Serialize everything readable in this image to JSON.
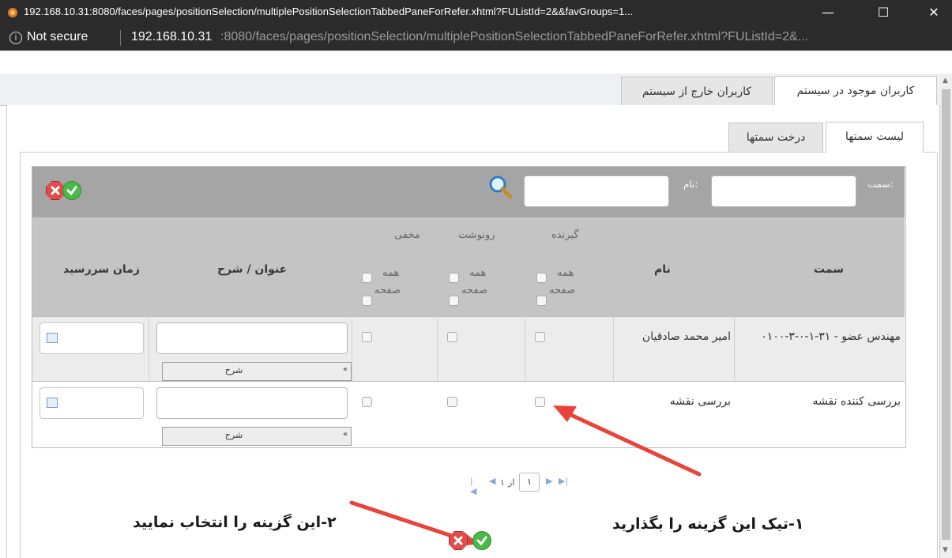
{
  "window": {
    "title": "192.168.10.31:8080/faces/pages/positionSelection/multiplePositionSelectionTabbedPaneForRefer.xhtml?FUListId=2&&favGroups=1...",
    "minimize": "—",
    "maximize": "☐",
    "close": "✕"
  },
  "addressbar": {
    "info_icon": "ⓘ",
    "security_label": "Not secure",
    "host": "192.168.10.31",
    "path": ":8080/faces/pages/positionSelection/multiplePositionSelectionTabbedPaneForRefer.xhtml?FUListId=2&..."
  },
  "tabs": {
    "main": [
      {
        "label": "کاربران موجود در سیستم",
        "active": true
      },
      {
        "label": "کاربران خارج از سیستم",
        "active": false
      }
    ],
    "inner": [
      {
        "label": "لیست سمتها",
        "active": true
      },
      {
        "label": "درخت سمتها",
        "active": false
      }
    ]
  },
  "filter": {
    "position_label": "سمت:",
    "name_label": "نام:",
    "search_icon": "search-icon",
    "ok_icon": "check-icon",
    "cancel_icon": "close-icon"
  },
  "table": {
    "headers": {
      "position": "سمت",
      "name": "نام",
      "recipient": "گیرنده",
      "copy": "رونوشت",
      "hidden": "مخفی",
      "title": "عنوان / شرح",
      "due": "زمان سررسید"
    },
    "sub": {
      "all": "همه",
      "page": "صفحه"
    },
    "rows": [
      {
        "position": "مهندس عضو - ۳۱-۱-۰-۳-۰۱۰۰",
        "name": "امیر محمد صادقیان",
        "sharh_label": "شرح"
      },
      {
        "position": "بررسی کننده نقشه",
        "name": "بررسی نقشه",
        "sharh_label": "شرح"
      }
    ]
  },
  "pager": {
    "first": "|◀",
    "prev": "◀",
    "of_label": "از",
    "current": "۱",
    "total": "۱",
    "next": "▶",
    "last": "▶|"
  },
  "annotations": {
    "step1": "۱-تیک این گزینه را بگذارید",
    "step2": "۲-این گزینه را انتخاب نمایید",
    "arrow_color": "#e8433c"
  },
  "colors": {
    "filter_bar": "#a5a5a5",
    "header_bar": "#c4c4c4",
    "ok": "#4ab84a",
    "cancel": "#e04b4b"
  }
}
